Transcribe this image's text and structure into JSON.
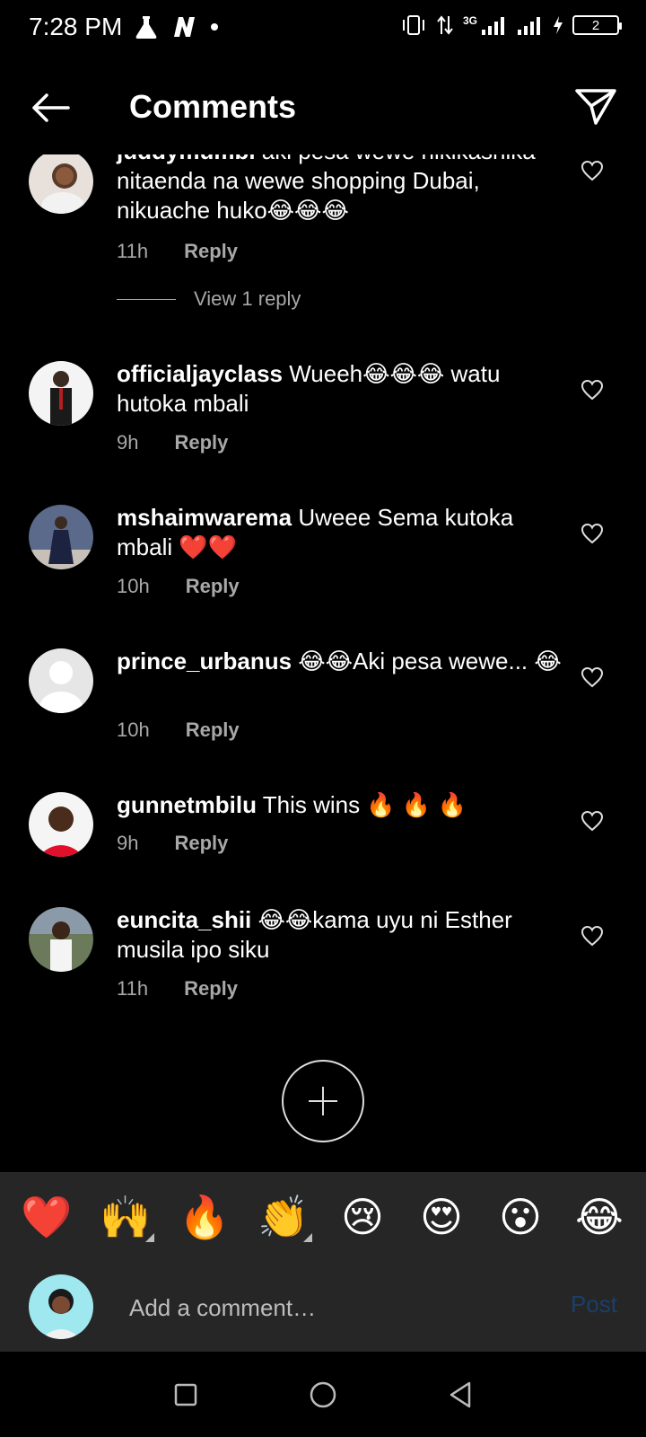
{
  "status": {
    "time": "7:28 PM",
    "network": "3G",
    "battery": "2"
  },
  "header": {
    "title": "Comments"
  },
  "comments": [
    {
      "username": "juddymumbi",
      "text": "aki pesa wewe nikikashika nitaenda na wewe shopping Dubai, nikuache huko😂😂😂",
      "time": "11h",
      "reply_label": "Reply",
      "view_replies": "View 1 reply"
    },
    {
      "username": "officialjayclass",
      "text": "Wueeh😂😂😂 watu hutoka mbali",
      "time": "9h",
      "reply_label": "Reply"
    },
    {
      "username": "mshaimwarema",
      "text": "Uweee Sema kutoka mbali ❤️❤️",
      "time": "10h",
      "reply_label": "Reply"
    },
    {
      "username": "prince_urbanus",
      "text": "😂😂Aki pesa wewe... 😂",
      "time": "10h",
      "reply_label": "Reply"
    },
    {
      "username": "gunnetmbilu",
      "text": "This wins 🔥 🔥 🔥",
      "time": "9h",
      "reply_label": "Reply"
    },
    {
      "username": "euncita_shii",
      "text": "😂😂kama uyu ni Esther musila ipo siku",
      "time": "11h",
      "reply_label": "Reply"
    }
  ],
  "emoji_bar": [
    "❤️",
    "🙌",
    "🔥",
    "👏",
    "😢",
    "😍",
    "😮",
    "😂"
  ],
  "composer": {
    "placeholder": "Add a comment…",
    "post_label": "Post"
  },
  "colors": {
    "background": "#000000",
    "panel": "#262626",
    "muted_text": "#a8a8a8",
    "post_disabled": "#1a3f6a"
  }
}
